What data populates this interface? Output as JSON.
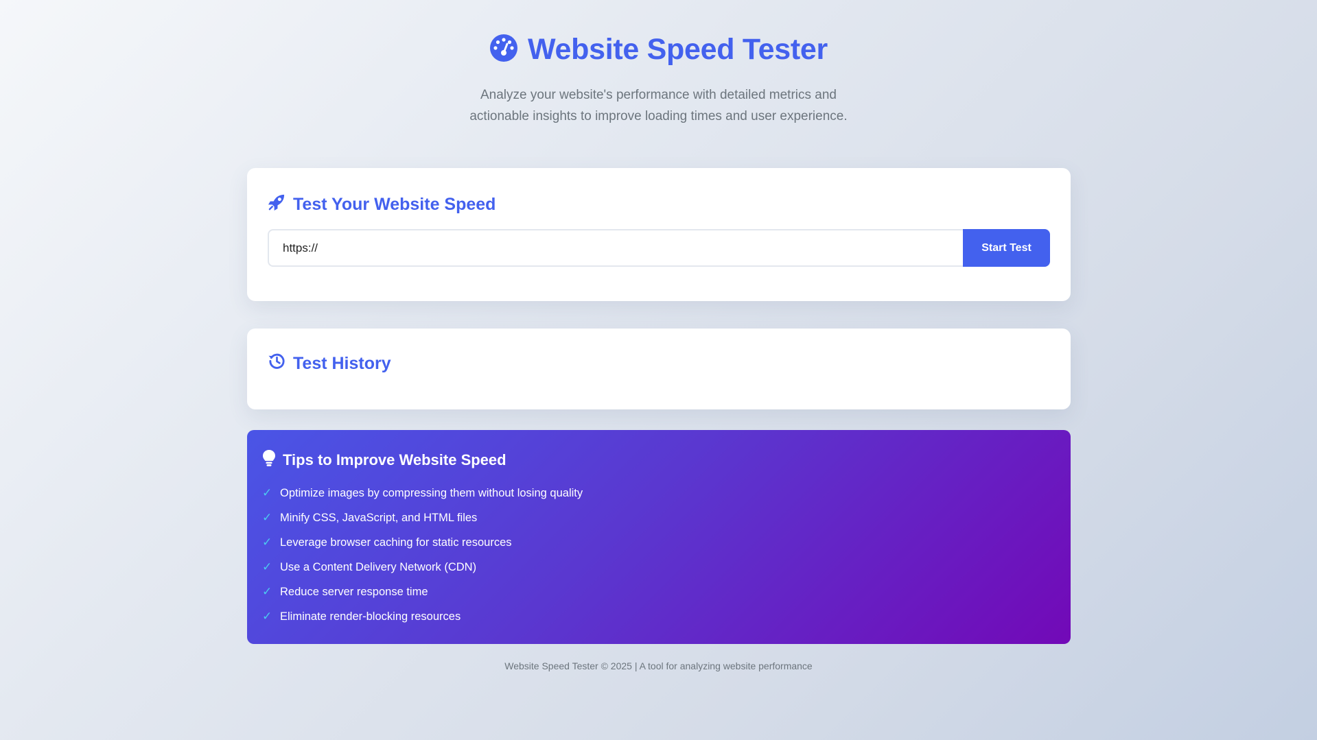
{
  "header": {
    "title": "Website Speed Tester",
    "title_icon": "gauge-icon",
    "subtitle": "Analyze your website's performance with detailed metrics and actionable insights to improve loading times and user experience."
  },
  "test_card": {
    "title": "Test Your Website Speed",
    "title_icon": "rocket-icon",
    "url_value": "https://",
    "button_label": "Start Test"
  },
  "history_card": {
    "title": "Test History",
    "title_icon": "history-icon"
  },
  "tips": {
    "title": "Tips to Improve Website Speed",
    "title_icon": "lightbulb-icon",
    "check_symbol": "✓",
    "items": [
      "Optimize images by compressing them without losing quality",
      "Minify CSS, JavaScript, and HTML files",
      "Leverage browser caching for static resources",
      "Use a Content Delivery Network (CDN)",
      "Reduce server response time",
      "Eliminate render-blocking resources"
    ]
  },
  "footer": {
    "text": "Website Speed Tester © 2025 | A tool for analyzing website performance"
  },
  "colors": {
    "accent": "#4361ee",
    "tips_gradient_start": "#4a55e6",
    "tips_gradient_end": "#7209b7",
    "check": "#4cc9f0",
    "muted_text": "#6c757d"
  }
}
